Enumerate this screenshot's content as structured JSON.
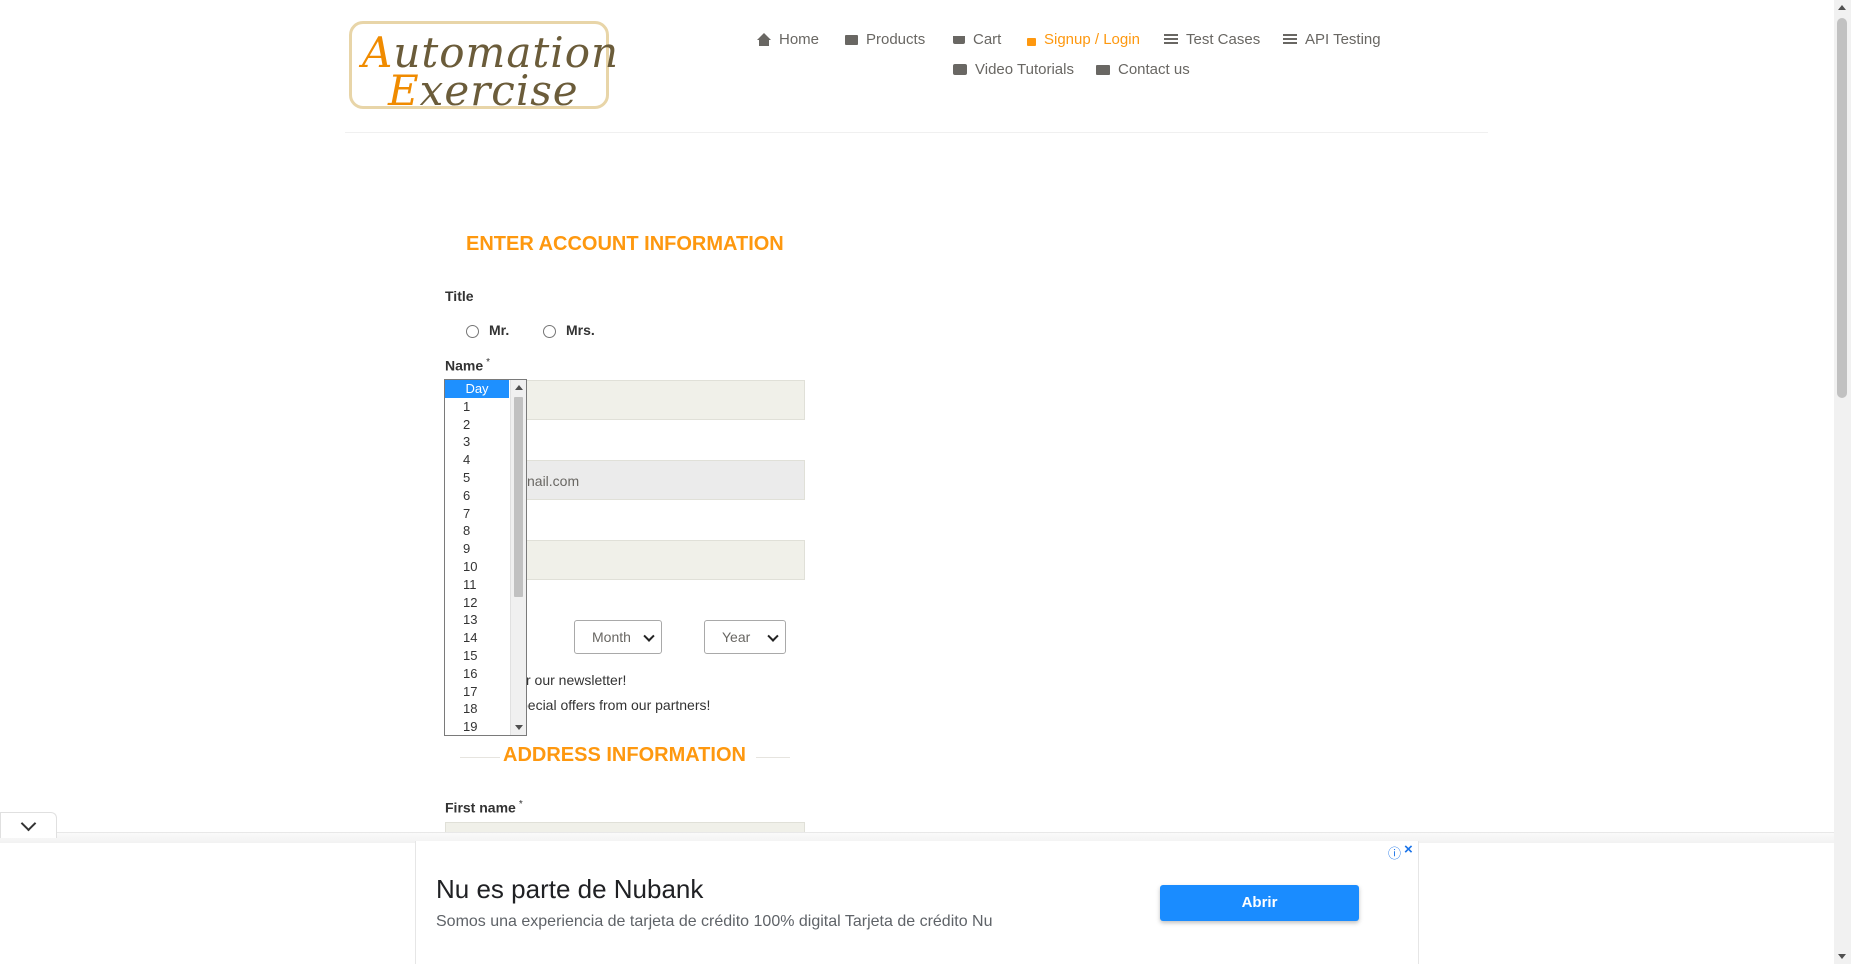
{
  "logo": {
    "line1_cap": "A",
    "line1_rest": "utomation",
    "line2_cap": "E",
    "line2_rest": "xercise"
  },
  "nav": {
    "home": "Home",
    "products": "Products",
    "cart": "Cart",
    "signup": "Signup / Login",
    "test_cases": "Test Cases",
    "api_testing": "API Testing",
    "video_tutorials": "Video Tutorials",
    "contact": "Contact us"
  },
  "form": {
    "heading": "ENTER ACCOUNT INFORMATION",
    "title_label": "Title",
    "title_options": [
      "Mr.",
      "Mrs."
    ],
    "name_label": "Name",
    "required_mark": "*",
    "email_value_visible": "nail.com",
    "month_select": "Month",
    "year_select": "Year",
    "newsletter_visible": "r our newsletter!",
    "offers_visible": "pecial offers from our partners!"
  },
  "day_dropdown": {
    "selected": "Day",
    "options": [
      "1",
      "2",
      "3",
      "4",
      "5",
      "6",
      "7",
      "8",
      "9",
      "10",
      "11",
      "12",
      "13",
      "14",
      "15",
      "16",
      "17",
      "18",
      "19"
    ]
  },
  "address": {
    "heading": "ADDRESS INFORMATION",
    "first_name_label": "First name"
  },
  "ad": {
    "headline": "Nu es parte de Nubank",
    "body": "Somos una experiencia de tarjeta de crédito 100% digital Tarjeta de crédito Nu",
    "cta": "Abrir"
  },
  "colors": {
    "accent": "#fe980f",
    "nav_text": "#696763",
    "ad_button": "#1a8cff"
  }
}
